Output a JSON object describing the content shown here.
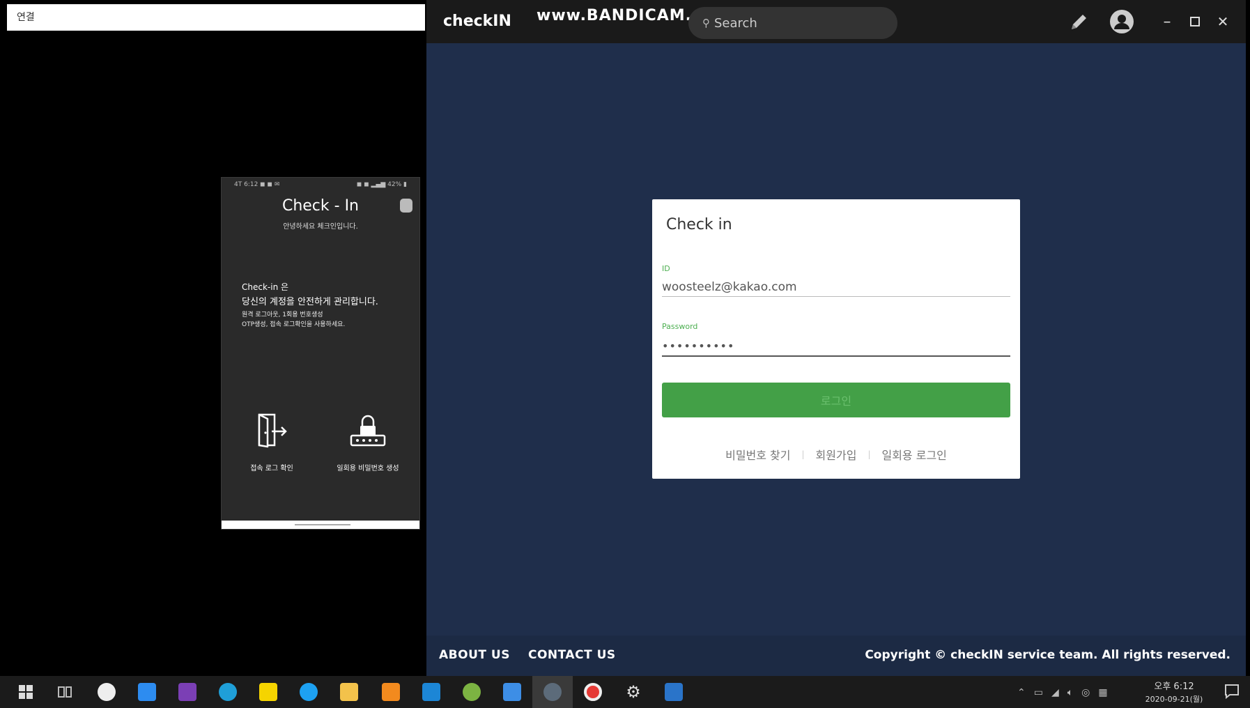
{
  "mirror_window": {
    "title": "연결"
  },
  "phone": {
    "status_left": "4T 6:12 ◼ ◼ ✉",
    "status_right": "◼ ◼ ▂▄▆ 42% ▮",
    "app_title": "Check - In",
    "subtitle": "안녕하세요 체크인입니다.",
    "description_line1": "Check-in 은",
    "description_line2": "당신의 계정을 안전하게 관리합니다.",
    "description_line3": "원격 로그아웃, 1회용 번호생성",
    "description_line4": "OTP생성, 접속 로그확인을 사용하세요.",
    "actions": [
      {
        "label": "접속 로그 확인",
        "icon": "door-exit-icon"
      },
      {
        "label": "일회용 비밀번호 생성",
        "icon": "lock-password-icon"
      }
    ]
  },
  "app": {
    "brand": "checkIN",
    "watermark": "www.BANDICAM.com",
    "search": {
      "placeholder": "Search"
    },
    "header_icons": [
      "pencil-icon",
      "account-circle-icon",
      "minimize-icon",
      "maximize-icon",
      "close-icon"
    ],
    "login": {
      "title": "Check in",
      "id_label": "ID",
      "id_value": "woosteelz@kakao.com",
      "password_label": "Password",
      "password_value": "••••••••••",
      "submit_label": "로그인",
      "links": [
        "비밀번호 찾기",
        "회원가입",
        "일회용 로그인"
      ]
    },
    "footer": {
      "about": "ABOUT US",
      "contact": "CONTACT US",
      "copyright": "Copyright © checkIN service team. All rights reserved."
    },
    "colors": {
      "background": "#1f2e4b",
      "header": "#1a1a1a",
      "accent_green": "#43a047"
    }
  },
  "taskbar": {
    "clock_time": "오후 6:12",
    "clock_date": "2020-09-21(월)",
    "pinned_icons": [
      "windows-start-icon",
      "task-view-icon",
      "paint-icon",
      "files-icon",
      "onenote-icon",
      "edge-icon",
      "kakaotalk-icon",
      "twitter-icon",
      "file-explorer-icon",
      "sublime-icon",
      "vscode-icon",
      "character-icon",
      "mail-icon",
      "electron-app-icon",
      "record-icon",
      "settings-icon",
      "app-icon"
    ]
  }
}
